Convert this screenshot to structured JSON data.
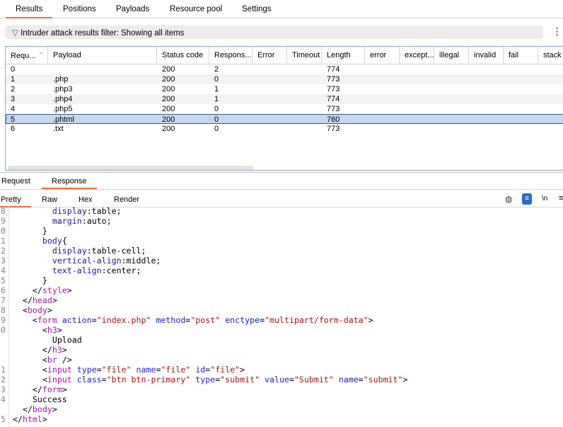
{
  "tabs": [
    "Results",
    "Positions",
    "Payloads",
    "Resource pool",
    "Settings"
  ],
  "filter": {
    "text": "Intruder attack results filter: Showing all items"
  },
  "table": {
    "columns": [
      "Requ...",
      "Payload",
      "Status code",
      "Respons...",
      "Error",
      "Timeout",
      "Length",
      "error",
      "except...",
      "illegal",
      "invalid",
      "fail",
      "stack"
    ],
    "sort": "ascending",
    "rows": [
      [
        "0",
        "",
        "200",
        "2",
        "",
        "",
        "774"
      ],
      [
        "1",
        ".php",
        "200",
        "0",
        "",
        "",
        "773"
      ],
      [
        "2",
        ".php3",
        "200",
        "1",
        "",
        "",
        "773"
      ],
      [
        "3",
        ".php4",
        "200",
        "1",
        "",
        "",
        "774"
      ],
      [
        "4",
        ".php5",
        "200",
        "0",
        "",
        "",
        "773"
      ],
      [
        "5",
        ".phtml",
        "200",
        "0",
        "",
        "",
        "760"
      ],
      [
        "6",
        ".txt",
        "200",
        "0",
        "",
        "",
        "773"
      ]
    ],
    "selected_row": 5
  },
  "msg_tabs": [
    "Request",
    "Response"
  ],
  "view_tabs": [
    "Pretty",
    "Raw",
    "Hex",
    "Render"
  ],
  "toolbar": {
    "newline_label": "\\n"
  },
  "code": [
    {
      "ln": "8",
      "tokens": [
        [
          "p",
          "        display"
        ],
        [
          "x",
          ":table;"
        ]
      ]
    },
    {
      "ln": "9",
      "tokens": [
        [
          "p",
          "        margin"
        ],
        [
          "x",
          ":auto;"
        ]
      ]
    },
    {
      "ln": "0",
      "tokens": [
        [
          "x",
          "      }"
        ]
      ]
    },
    {
      "ln": "1",
      "tokens": [
        [
          "p",
          "      body"
        ],
        [
          "x",
          "{"
        ]
      ]
    },
    {
      "ln": "2",
      "tokens": [
        [
          "p",
          "        display"
        ],
        [
          "x",
          ":table-cell;"
        ]
      ]
    },
    {
      "ln": "3",
      "tokens": [
        [
          "p",
          "        vertical-align"
        ],
        [
          "x",
          ":middle;"
        ]
      ]
    },
    {
      "ln": "4",
      "tokens": [
        [
          "p",
          "        text-align"
        ],
        [
          "x",
          ":center;"
        ]
      ]
    },
    {
      "ln": "5",
      "tokens": [
        [
          "x",
          "      }"
        ]
      ]
    },
    {
      "ln": "6",
      "tokens": [
        [
          "x",
          "    </"
        ],
        [
          "t",
          "style"
        ],
        [
          "x",
          ">"
        ]
      ]
    },
    {
      "ln": "7",
      "tokens": [
        [
          "x",
          "  </"
        ],
        [
          "t",
          "head"
        ],
        [
          "x",
          ">"
        ]
      ]
    },
    {
      "ln": "8",
      "tokens": [
        [
          "x",
          "  <"
        ],
        [
          "t",
          "body"
        ],
        [
          "x",
          ">"
        ]
      ]
    },
    {
      "ln": "9",
      "tokens": [
        [
          "x",
          "    <"
        ],
        [
          "t",
          "form "
        ],
        [
          "a",
          "action"
        ],
        [
          "x",
          "="
        ],
        [
          "v",
          "\"index.php\" "
        ],
        [
          "a",
          "method"
        ],
        [
          "x",
          "="
        ],
        [
          "v",
          "\"post\" "
        ],
        [
          "a",
          "enctype"
        ],
        [
          "x",
          "="
        ],
        [
          "v",
          "\"multipart/form-data\""
        ],
        [
          "x",
          ">"
        ]
      ]
    },
    {
      "ln": "0",
      "tokens": [
        [
          "x",
          "      <"
        ],
        [
          "t",
          "h3"
        ],
        [
          "x",
          ">"
        ]
      ]
    },
    {
      "ln": "",
      "tokens": [
        [
          "x",
          "        Upload"
        ]
      ]
    },
    {
      "ln": "",
      "tokens": [
        [
          "x",
          "      </"
        ],
        [
          "t",
          "h3"
        ],
        [
          "x",
          ">"
        ]
      ]
    },
    {
      "ln": "",
      "tokens": [
        [
          "x",
          "      <"
        ],
        [
          "t",
          "br "
        ],
        [
          "x",
          "/>"
        ]
      ]
    },
    {
      "ln": "1",
      "tokens": [
        [
          "x",
          "      <"
        ],
        [
          "t",
          "input "
        ],
        [
          "a",
          "type"
        ],
        [
          "x",
          "="
        ],
        [
          "v",
          "\"file\" "
        ],
        [
          "a",
          "name"
        ],
        [
          "x",
          "="
        ],
        [
          "v",
          "\"file\" "
        ],
        [
          "a",
          "id"
        ],
        [
          "x",
          "="
        ],
        [
          "v",
          "\"file\""
        ],
        [
          "x",
          ">"
        ]
      ]
    },
    {
      "ln": "2",
      "tokens": [
        [
          "x",
          "      <"
        ],
        [
          "t",
          "input "
        ],
        [
          "a",
          "class"
        ],
        [
          "x",
          "="
        ],
        [
          "v",
          "\"btn btn-primary\" "
        ],
        [
          "a",
          "type"
        ],
        [
          "x",
          "="
        ],
        [
          "v",
          "\"submit\" "
        ],
        [
          "a",
          "value"
        ],
        [
          "x",
          "="
        ],
        [
          "v",
          "\"Submit\" "
        ],
        [
          "a",
          "name"
        ],
        [
          "x",
          "="
        ],
        [
          "v",
          "\"submit\""
        ],
        [
          "x",
          ">"
        ]
      ]
    },
    {
      "ln": "3",
      "tokens": [
        [
          "x",
          "    </"
        ],
        [
          "t",
          "form"
        ],
        [
          "x",
          ">"
        ]
      ]
    },
    {
      "ln": "4",
      "tokens": [
        [
          "x",
          "    Success"
        ]
      ]
    },
    {
      "ln": "",
      "tokens": [
        [
          "x",
          "  </"
        ],
        [
          "t",
          "body"
        ],
        [
          "x",
          ">"
        ]
      ]
    },
    {
      "ln": "5",
      "tokens": [
        [
          "x",
          "</"
        ],
        [
          "t",
          "html"
        ],
        [
          "x",
          ">"
        ]
      ]
    }
  ]
}
